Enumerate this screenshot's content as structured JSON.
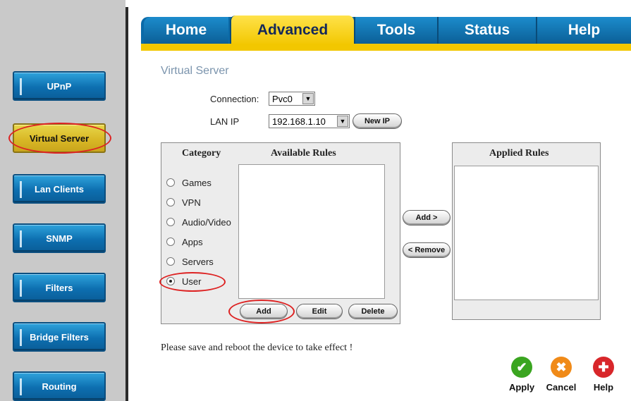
{
  "sidebar": {
    "items": [
      {
        "label": "UPnP"
      },
      {
        "label": "Virtual Server"
      },
      {
        "label": "Lan Clients"
      },
      {
        "label": "SNMP"
      },
      {
        "label": "Filters"
      },
      {
        "label": "Bridge Filters"
      },
      {
        "label": "Routing"
      }
    ],
    "active_index": 1
  },
  "tabs": [
    {
      "label": "Home"
    },
    {
      "label": "Advanced"
    },
    {
      "label": "Tools"
    },
    {
      "label": "Status"
    },
    {
      "label": "Help"
    }
  ],
  "active_tab": "Advanced",
  "page": {
    "title": "Virtual Server",
    "connection_label": "Connection:",
    "connection_value": "Pvc0",
    "lan_ip_label": "LAN IP",
    "lan_ip_value": "192.168.1.10",
    "new_ip_button": "New IP",
    "category_header": "Category",
    "available_header": "Available Rules",
    "applied_header": "Applied Rules",
    "categories": [
      {
        "label": "Games",
        "selected": false
      },
      {
        "label": "VPN",
        "selected": false
      },
      {
        "label": "Audio/Video",
        "selected": false
      },
      {
        "label": "Apps",
        "selected": false
      },
      {
        "label": "Servers",
        "selected": false
      },
      {
        "label": "User",
        "selected": true
      }
    ],
    "add_rule_button": "Add >",
    "remove_rule_button": "< Remove",
    "add_button": "Add",
    "edit_button": "Edit",
    "delete_button": "Delete",
    "note": "Please save and reboot the device to take effect !"
  },
  "actions": {
    "apply": "Apply",
    "cancel": "Cancel",
    "help": "Help"
  },
  "colors": {
    "tab_blue": "#0b6aa8",
    "tab_active": "#f2c700",
    "highlight_ring": "#dd2222",
    "apply_green": "#3aa520",
    "cancel_orange": "#f08a18",
    "help_red": "#d8262a"
  }
}
